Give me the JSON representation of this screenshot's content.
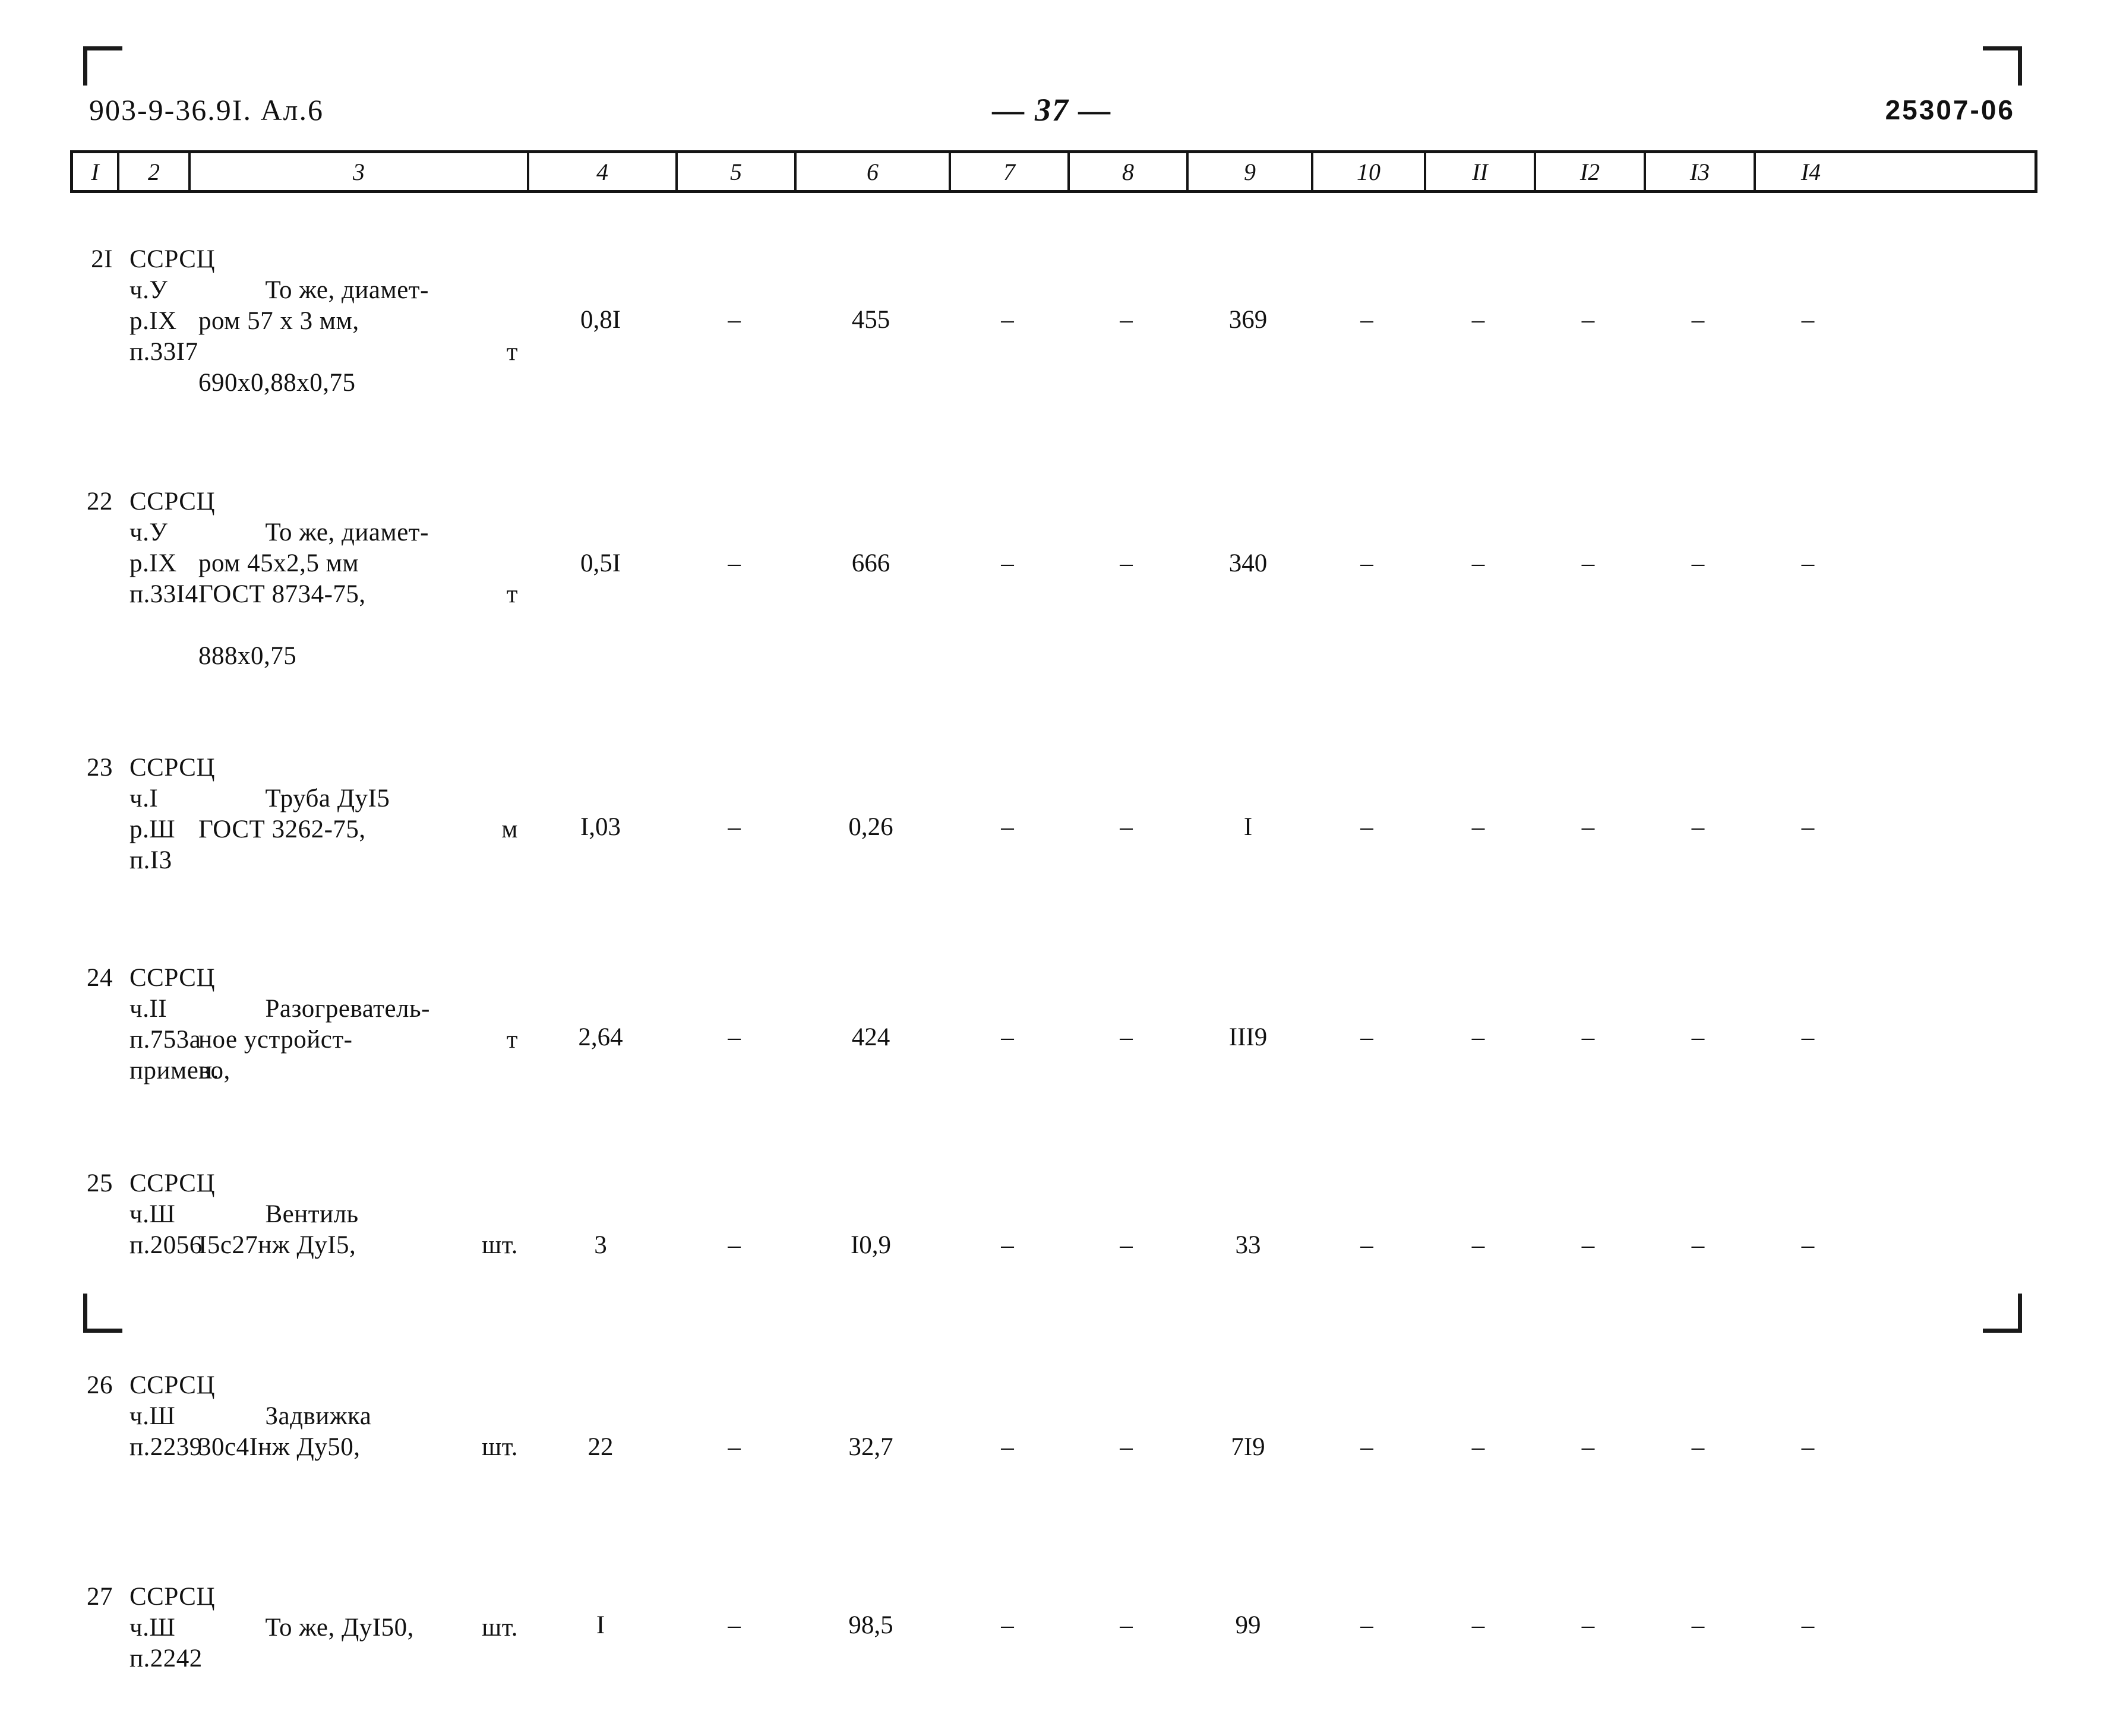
{
  "header": {
    "doc_code": "903-9-36.9I. Ал.6",
    "page_number": "— 37 —",
    "stamp": "25307-06"
  },
  "table": {
    "column_headers": [
      "I",
      "2",
      "3",
      "4",
      "5",
      "6",
      "7",
      "8",
      "9",
      "10",
      "II",
      "I2",
      "I3",
      "I4"
    ],
    "dash": "–",
    "rows": [
      {
        "num": "2I",
        "code": "ССРСЦ\nч.У\nр.IX\nп.33I7",
        "desc": "То же, диамет-\nром 57 х 3 мм,\n\n690х0,88х0,75",
        "unit": "т",
        "c4": "0,8I",
        "c5": "–",
        "c6": "455",
        "c7": "–",
        "c8": "–",
        "c9": "369",
        "c10": "–",
        "c11": "–",
        "c12": "–",
        "c13": "–",
        "c14": "–"
      },
      {
        "num": "22",
        "code": "ССРСЦ\nч.У\nр.IX\nп.33I4",
        "desc": "То же, диамет-\nром 45х2,5 мм\nГОСТ 8734-75,\n\n888х0,75",
        "unit": "т",
        "c4": "0,5I",
        "c5": "–",
        "c6": "666",
        "c7": "–",
        "c8": "–",
        "c9": "340",
        "c10": "–",
        "c11": "–",
        "c12": "–",
        "c13": "–",
        "c14": "–"
      },
      {
        "num": "23",
        "code": "ССРСЦ\nч.I\nр.Ш\nп.I3",
        "desc": "Труба ДуI5\nГОСТ 3262-75,\n",
        "unit": "м",
        "c4": "I,03",
        "c5": "–",
        "c6": "0,26",
        "c7": "–",
        "c8": "–",
        "c9": "I",
        "c10": "–",
        "c11": "–",
        "c12": "–",
        "c13": "–",
        "c14": "–"
      },
      {
        "num": "24",
        "code": "ССРСЦ\nч.II\nп.753а\nпримен.",
        "desc": "Разогреватель-\nное устройст-\nво,",
        "unit": "т",
        "c4": "2,64",
        "c5": "–",
        "c6": "424",
        "c7": "–",
        "c8": "–",
        "c9": "III9",
        "c10": "–",
        "c11": "–",
        "c12": "–",
        "c13": "–",
        "c14": "–"
      },
      {
        "num": "25",
        "code": "ССРСЦ\nч.Ш\nп.2056",
        "desc": "Вентиль\nI5с27нж ДуI5,\n",
        "unit": "шт.",
        "c4": "3",
        "c5": "–",
        "c6": "I0,9",
        "c7": "–",
        "c8": "–",
        "c9": "33",
        "c10": "–",
        "c11": "–",
        "c12": "–",
        "c13": "–",
        "c14": "–"
      },
      {
        "num": "26",
        "code": "ССРСЦ\nч.Ш\nп.2239",
        "desc": "Задвижка\n30с4Iнж Ду50,\n",
        "unit": "шт.",
        "c4": "22",
        "c5": "–",
        "c6": "32,7",
        "c7": "–",
        "c8": "–",
        "c9": "7I9",
        "c10": "–",
        "c11": "–",
        "c12": "–",
        "c13": "–",
        "c14": "–"
      },
      {
        "num": "27",
        "code": "ССРСЦ\nч.Ш\nп.2242",
        "desc": "То же, ДуI50,\n",
        "unit": "шт.",
        "c4": "I",
        "c5": "–",
        "c6": "98,5",
        "c7": "–",
        "c8": "–",
        "c9": "99",
        "c10": "–",
        "c11": "–",
        "c12": "–",
        "c13": "–",
        "c14": "–"
      }
    ]
  }
}
